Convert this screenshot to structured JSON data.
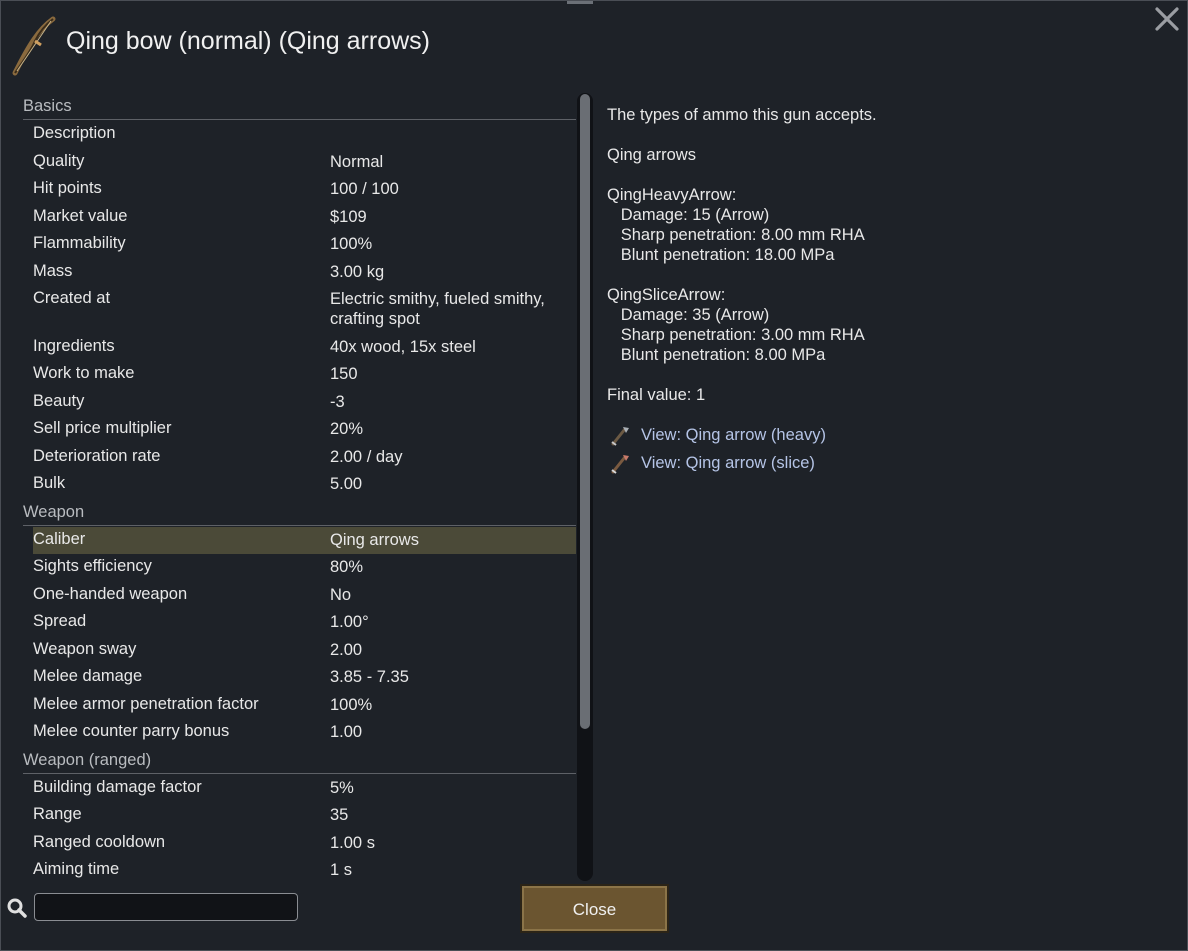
{
  "window": {
    "title": "Qing bow (normal) (Qing arrows)"
  },
  "sections": [
    {
      "label": "Basics",
      "rows": [
        {
          "k": "Description",
          "v": ""
        },
        {
          "k": "Quality",
          "v": "Normal"
        },
        {
          "k": "Hit points",
          "v": "100 / 100"
        },
        {
          "k": "Market value",
          "v": "$109"
        },
        {
          "k": "Flammability",
          "v": "100%"
        },
        {
          "k": "Mass",
          "v": "3.00 kg"
        },
        {
          "k": "Created at",
          "v": "Electric smithy, fueled smithy, crafting spot"
        },
        {
          "k": "Ingredients",
          "v": "40x wood, 15x steel"
        },
        {
          "k": "Work to make",
          "v": "150"
        },
        {
          "k": "Beauty",
          "v": "-3"
        },
        {
          "k": "Sell price multiplier",
          "v": "20%"
        },
        {
          "k": "Deterioration rate",
          "v": "2.00 / day"
        },
        {
          "k": "Bulk",
          "v": "5.00"
        }
      ]
    },
    {
      "label": "Weapon",
      "rows": [
        {
          "k": "Caliber",
          "v": "Qing arrows"
        },
        {
          "k": "Sights efficiency",
          "v": "80%"
        },
        {
          "k": "One-handed weapon",
          "v": "No"
        },
        {
          "k": "Spread",
          "v": "1.00°"
        },
        {
          "k": "Weapon sway",
          "v": "2.00"
        },
        {
          "k": "Melee damage",
          "v": "3.85 - 7.35"
        },
        {
          "k": "Melee armor penetration factor",
          "v": "100%"
        },
        {
          "k": "Melee counter parry bonus",
          "v": "1.00"
        }
      ]
    },
    {
      "label": "Weapon (ranged)",
      "rows": [
        {
          "k": "Building damage factor",
          "v": "5%"
        },
        {
          "k": "Range",
          "v": "35"
        },
        {
          "k": "Ranged cooldown",
          "v": "1.00 s"
        },
        {
          "k": "Aiming time",
          "v": "1 s"
        }
      ]
    }
  ],
  "selected_row": "Caliber",
  "description": {
    "intro": "The types of ammo this gun accepts.",
    "ammo_set": "Qing arrows",
    "heavy": {
      "name": "QingHeavyArrow:",
      "damage": "   Damage: 15 (Arrow)",
      "sharp": "   Sharp penetration: 8.00 mm RHA",
      "blunt": "   Blunt penetration: 18.00 MPa"
    },
    "slice": {
      "name": "QingSliceArrow:",
      "damage": "   Damage: 35 (Arrow)",
      "sharp": "   Sharp penetration: 3.00 mm RHA",
      "blunt": "   Blunt penetration: 8.00 MPa"
    },
    "final_value": "Final value: 1",
    "links": [
      {
        "label": "View: Qing arrow (heavy)",
        "icon": "arrow-heavy-icon"
      },
      {
        "label": "View: Qing arrow (slice)",
        "icon": "arrow-slice-icon"
      }
    ]
  },
  "search": {
    "value": "",
    "placeholder": ""
  },
  "buttons": {
    "close_label": "Close"
  },
  "colors": {
    "accent_button": "#6b5530",
    "link": "#b5c4e6",
    "selected_row": "#4b4a38"
  }
}
